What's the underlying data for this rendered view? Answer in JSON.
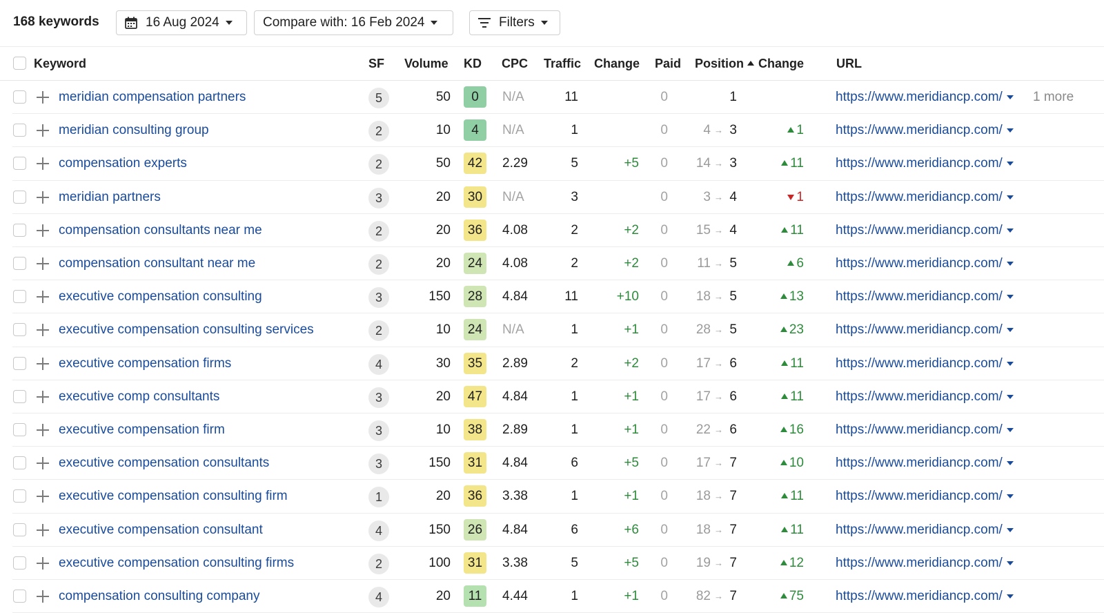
{
  "toolbar": {
    "keyword_count": "168 keywords",
    "date_label": "16 Aug 2024",
    "compare_label": "Compare with: 16 Feb 2024",
    "filters_label": "Filters"
  },
  "columns": {
    "keyword": "Keyword",
    "sf": "SF",
    "volume": "Volume",
    "kd": "KD",
    "cpc": "CPC",
    "traffic": "Traffic",
    "traffic_change": "Change",
    "paid": "Paid",
    "position": "Position",
    "position_change": "Change",
    "url": "URL"
  },
  "colors": {
    "link": "#1a4b9b",
    "positive": "#2e8b3c",
    "negative": "#c62828",
    "kd_green": "#8fcfa3",
    "kd_lightgreen": "#cfe5b4",
    "kd_yellow": "#f3e58a"
  },
  "rows": [
    {
      "keyword": "meridian compensation partners",
      "sf": "5",
      "volume": "50",
      "kd": "0",
      "kd_color": "#8fcfa3",
      "cpc": "N/A",
      "traffic": "11",
      "traffic_change": "",
      "paid": "0",
      "pos_old": "",
      "pos_new": "1",
      "pos_change": "",
      "pos_dir": "",
      "url": "https://www.meridiancp.com/",
      "more": "1 more"
    },
    {
      "keyword": "meridian consulting group",
      "sf": "2",
      "volume": "10",
      "kd": "4",
      "kd_color": "#8fcfa3",
      "cpc": "N/A",
      "traffic": "1",
      "traffic_change": "",
      "paid": "0",
      "pos_old": "4",
      "pos_new": "3",
      "pos_change": "1",
      "pos_dir": "up",
      "url": "https://www.meridiancp.com/",
      "more": ""
    },
    {
      "keyword": "compensation experts",
      "sf": "2",
      "volume": "50",
      "kd": "42",
      "kd_color": "#f3e58a",
      "cpc": "2.29",
      "traffic": "5",
      "traffic_change": "+5",
      "paid": "0",
      "pos_old": "14",
      "pos_new": "3",
      "pos_change": "11",
      "pos_dir": "up",
      "url": "https://www.meridiancp.com/",
      "more": ""
    },
    {
      "keyword": "meridian partners",
      "sf": "3",
      "volume": "20",
      "kd": "30",
      "kd_color": "#f3e58a",
      "cpc": "N/A",
      "traffic": "3",
      "traffic_change": "",
      "paid": "0",
      "pos_old": "3",
      "pos_new": "4",
      "pos_change": "1",
      "pos_dir": "down",
      "url": "https://www.meridiancp.com/",
      "more": ""
    },
    {
      "keyword": "compensation consultants near me",
      "sf": "2",
      "volume": "20",
      "kd": "36",
      "kd_color": "#f3e58a",
      "cpc": "4.08",
      "traffic": "2",
      "traffic_change": "+2",
      "paid": "0",
      "pos_old": "15",
      "pos_new": "4",
      "pos_change": "11",
      "pos_dir": "up",
      "url": "https://www.meridiancp.com/",
      "more": ""
    },
    {
      "keyword": "compensation consultant near me",
      "sf": "2",
      "volume": "20",
      "kd": "24",
      "kd_color": "#cfe5b4",
      "cpc": "4.08",
      "traffic": "2",
      "traffic_change": "+2",
      "paid": "0",
      "pos_old": "11",
      "pos_new": "5",
      "pos_change": "6",
      "pos_dir": "up",
      "url": "https://www.meridiancp.com/",
      "more": ""
    },
    {
      "keyword": "executive compensation consulting",
      "sf": "3",
      "volume": "150",
      "kd": "28",
      "kd_color": "#cfe5b4",
      "cpc": "4.84",
      "traffic": "11",
      "traffic_change": "+10",
      "paid": "0",
      "pos_old": "18",
      "pos_new": "5",
      "pos_change": "13",
      "pos_dir": "up",
      "url": "https://www.meridiancp.com/",
      "more": ""
    },
    {
      "keyword": "executive compensation consulting services",
      "sf": "2",
      "volume": "10",
      "kd": "24",
      "kd_color": "#cfe5b4",
      "cpc": "N/A",
      "traffic": "1",
      "traffic_change": "+1",
      "paid": "0",
      "pos_old": "28",
      "pos_new": "5",
      "pos_change": "23",
      "pos_dir": "up",
      "url": "https://www.meridiancp.com/",
      "more": ""
    },
    {
      "keyword": "executive compensation firms",
      "sf": "4",
      "volume": "30",
      "kd": "35",
      "kd_color": "#f3e58a",
      "cpc": "2.89",
      "traffic": "2",
      "traffic_change": "+2",
      "paid": "0",
      "pos_old": "17",
      "pos_new": "6",
      "pos_change": "11",
      "pos_dir": "up",
      "url": "https://www.meridiancp.com/",
      "more": ""
    },
    {
      "keyword": "executive comp consultants",
      "sf": "3",
      "volume": "20",
      "kd": "47",
      "kd_color": "#f3e58a",
      "cpc": "4.84",
      "traffic": "1",
      "traffic_change": "+1",
      "paid": "0",
      "pos_old": "17",
      "pos_new": "6",
      "pos_change": "11",
      "pos_dir": "up",
      "url": "https://www.meridiancp.com/",
      "more": ""
    },
    {
      "keyword": "executive compensation firm",
      "sf": "3",
      "volume": "10",
      "kd": "38",
      "kd_color": "#f3e58a",
      "cpc": "2.89",
      "traffic": "1",
      "traffic_change": "+1",
      "paid": "0",
      "pos_old": "22",
      "pos_new": "6",
      "pos_change": "16",
      "pos_dir": "up",
      "url": "https://www.meridiancp.com/",
      "more": ""
    },
    {
      "keyword": "executive compensation consultants",
      "sf": "3",
      "volume": "150",
      "kd": "31",
      "kd_color": "#f3e58a",
      "cpc": "4.84",
      "traffic": "6",
      "traffic_change": "+5",
      "paid": "0",
      "pos_old": "17",
      "pos_new": "7",
      "pos_change": "10",
      "pos_dir": "up",
      "url": "https://www.meridiancp.com/",
      "more": ""
    },
    {
      "keyword": "executive compensation consulting firm",
      "sf": "1",
      "volume": "20",
      "kd": "36",
      "kd_color": "#f3e58a",
      "cpc": "3.38",
      "traffic": "1",
      "traffic_change": "+1",
      "paid": "0",
      "pos_old": "18",
      "pos_new": "7",
      "pos_change": "11",
      "pos_dir": "up",
      "url": "https://www.meridiancp.com/",
      "more": ""
    },
    {
      "keyword": "executive compensation consultant",
      "sf": "4",
      "volume": "150",
      "kd": "26",
      "kd_color": "#cfe5b4",
      "cpc": "4.84",
      "traffic": "6",
      "traffic_change": "+6",
      "paid": "0",
      "pos_old": "18",
      "pos_new": "7",
      "pos_change": "11",
      "pos_dir": "up",
      "url": "https://www.meridiancp.com/",
      "more": ""
    },
    {
      "keyword": "executive compensation consulting firms",
      "sf": "2",
      "volume": "100",
      "kd": "31",
      "kd_color": "#f3e58a",
      "cpc": "3.38",
      "traffic": "5",
      "traffic_change": "+5",
      "paid": "0",
      "pos_old": "19",
      "pos_new": "7",
      "pos_change": "12",
      "pos_dir": "up",
      "url": "https://www.meridiancp.com/",
      "more": ""
    },
    {
      "keyword": "compensation consulting company",
      "sf": "4",
      "volume": "20",
      "kd": "11",
      "kd_color": "#b5e0b0",
      "cpc": "4.44",
      "traffic": "1",
      "traffic_change": "+1",
      "paid": "0",
      "pos_old": "82",
      "pos_new": "7",
      "pos_change": "75",
      "pos_dir": "up",
      "url": "https://www.meridiancp.com/",
      "more": ""
    }
  ]
}
